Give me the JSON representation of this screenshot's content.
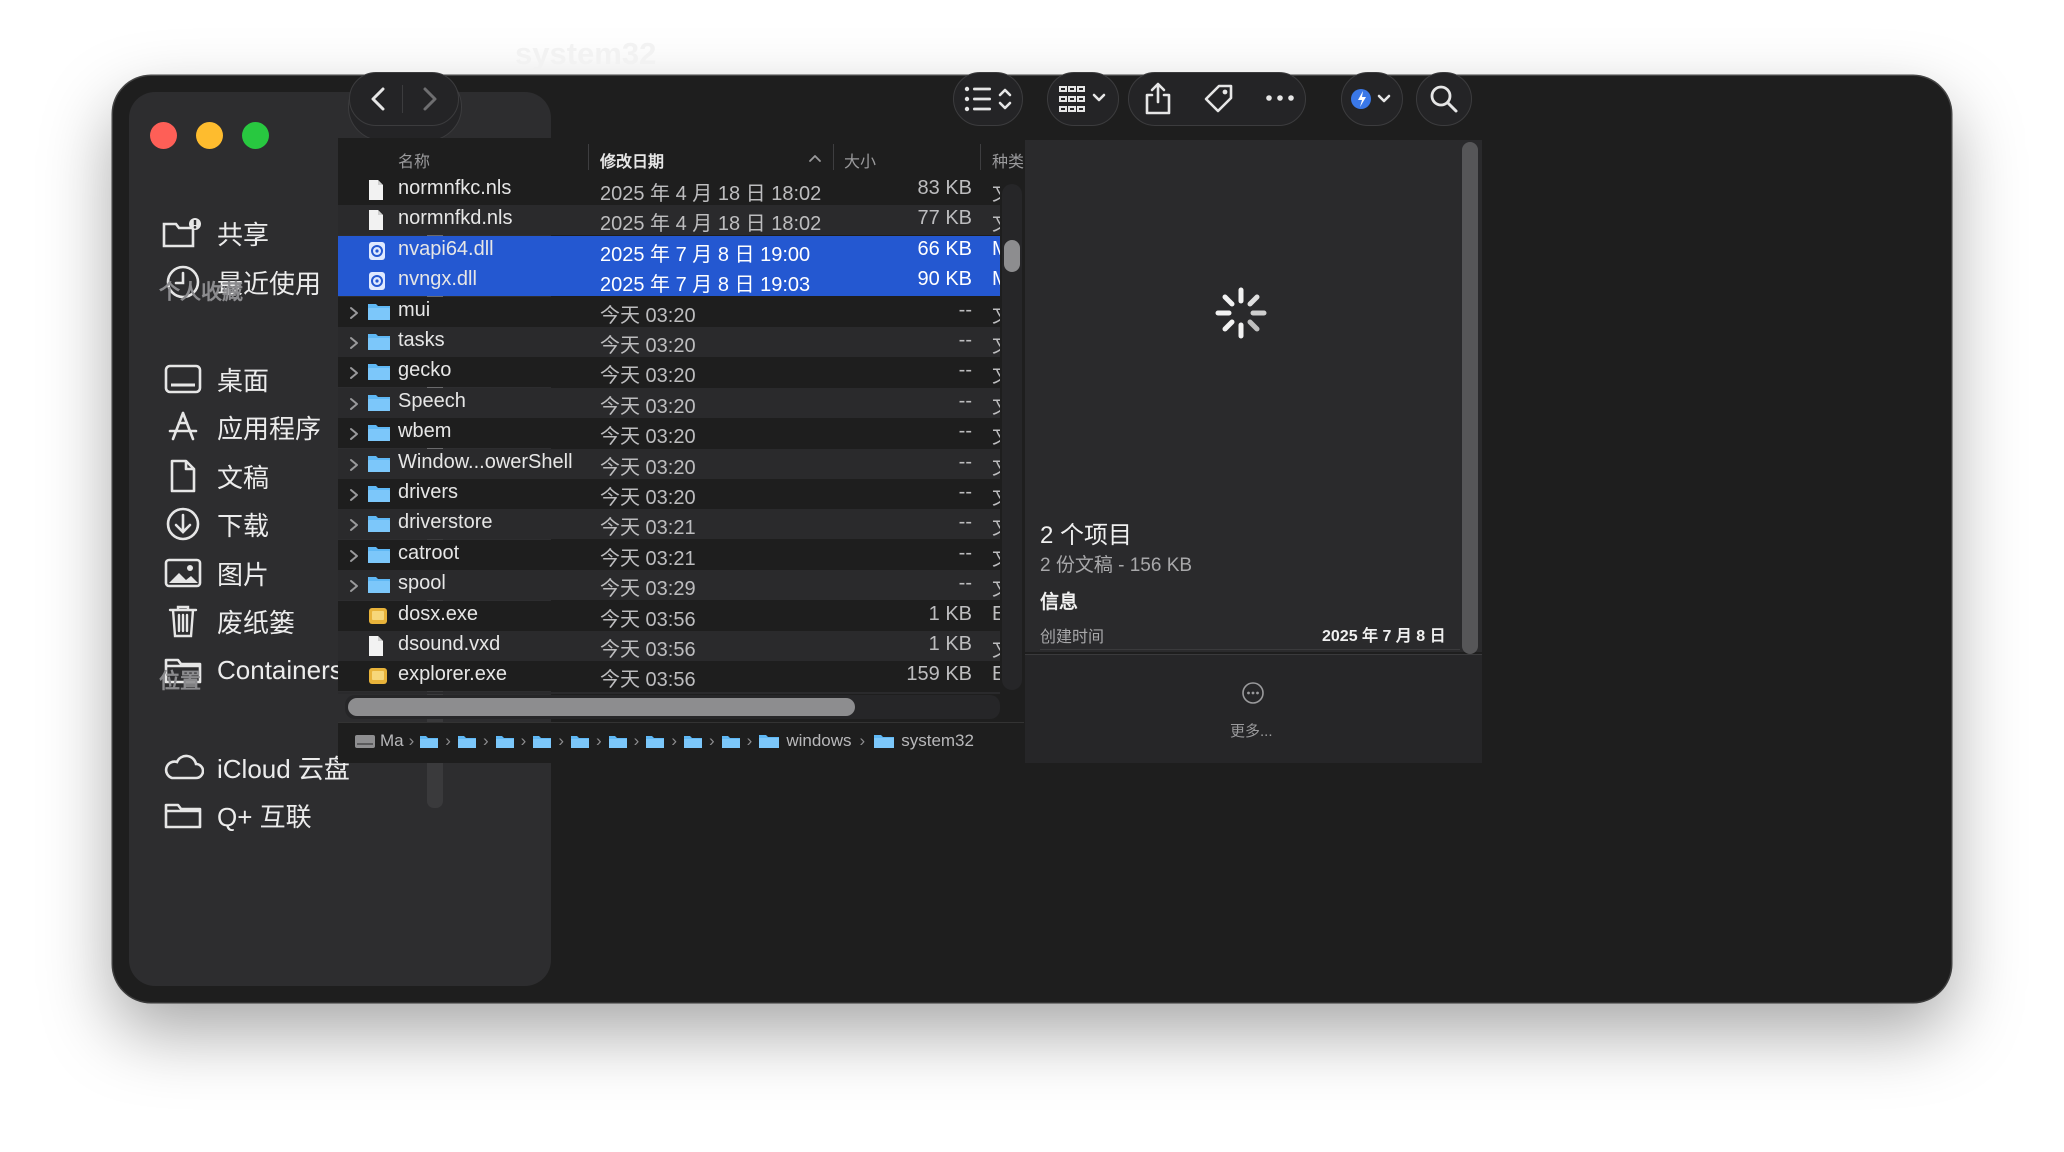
{
  "window": {
    "title": "system32"
  },
  "sidebar": {
    "top_items": [
      {
        "label": "共享",
        "icon": "shared-folder-icon"
      },
      {
        "label": "最近使用",
        "icon": "clock-icon"
      }
    ],
    "favorites_header": "个人收藏",
    "favorites": [
      {
        "label": "桌面",
        "icon": "desktop-icon"
      },
      {
        "label": "应用程序",
        "icon": "applications-icon"
      },
      {
        "label": "文稿",
        "icon": "document-icon"
      },
      {
        "label": "下载",
        "icon": "download-icon"
      },
      {
        "label": "图片",
        "icon": "photo-icon"
      },
      {
        "label": "废纸篓",
        "icon": "trash-icon"
      },
      {
        "label": "Containers",
        "icon": "folder-icon"
      }
    ],
    "locations_header": "位置",
    "locations": [
      {
        "label": "iCloud 云盘",
        "icon": "cloud-icon"
      },
      {
        "label": "Q+ 互联",
        "icon": "folder-icon"
      }
    ]
  },
  "columns": {
    "name": "名称",
    "date": "修改日期",
    "size": "大小",
    "kind": "种类"
  },
  "files": [
    {
      "name": "normnfkc.nls",
      "date": "2025 年 4 月 18 日 18:02",
      "size": "83 KB",
      "kind": "文",
      "type": "doc",
      "selected": false
    },
    {
      "name": "normnfkd.nls",
      "date": "2025 年 4 月 18 日 18:02",
      "size": "77 KB",
      "kind": "文",
      "type": "doc",
      "selected": false
    },
    {
      "name": "nvapi64.dll",
      "date": "2025 年 7 月 8 日 19:00",
      "size": "66 KB",
      "kind": "M",
      "type": "dll",
      "selected": true
    },
    {
      "name": "nvngx.dll",
      "date": "2025 年 7 月 8 日 19:03",
      "size": "90 KB",
      "kind": "M",
      "type": "dll",
      "selected": true
    },
    {
      "name": "mui",
      "date": "今天 03:20",
      "size": "--",
      "kind": "文",
      "type": "folder",
      "selected": false
    },
    {
      "name": "tasks",
      "date": "今天 03:20",
      "size": "--",
      "kind": "文",
      "type": "folder",
      "selected": false
    },
    {
      "name": "gecko",
      "date": "今天 03:20",
      "size": "--",
      "kind": "文",
      "type": "folder",
      "selected": false
    },
    {
      "name": "Speech",
      "date": "今天 03:20",
      "size": "--",
      "kind": "文",
      "type": "folder",
      "selected": false
    },
    {
      "name": "wbem",
      "date": "今天 03:20",
      "size": "--",
      "kind": "文",
      "type": "folder",
      "selected": false
    },
    {
      "name": "Window...owerShell",
      "date": "今天 03:20",
      "size": "--",
      "kind": "文",
      "type": "folder",
      "selected": false
    },
    {
      "name": "drivers",
      "date": "今天 03:20",
      "size": "--",
      "kind": "文",
      "type": "folder",
      "selected": false
    },
    {
      "name": "driverstore",
      "date": "今天 03:21",
      "size": "--",
      "kind": "文",
      "type": "folder",
      "selected": false
    },
    {
      "name": "catroot",
      "date": "今天 03:21",
      "size": "--",
      "kind": "文",
      "type": "folder",
      "selected": false
    },
    {
      "name": "spool",
      "date": "今天 03:29",
      "size": "--",
      "kind": "文",
      "type": "folder",
      "selected": false
    },
    {
      "name": "dosx.exe",
      "date": "今天 03:56",
      "size": "1 KB",
      "kind": "E",
      "type": "exe",
      "selected": false
    },
    {
      "name": "dsound.vxd",
      "date": "今天 03:56",
      "size": "1 KB",
      "kind": "文",
      "type": "doc",
      "selected": false
    },
    {
      "name": "explorer.exe",
      "date": "今天 03:56",
      "size": "159 KB",
      "kind": "E",
      "type": "exe",
      "selected": false
    },
    {
      "name": "",
      "date": "",
      "size": "",
      "kind": "",
      "type": "doc",
      "selected": false
    }
  ],
  "pathbar": {
    "root_label": "Ma",
    "folders": [
      "windows",
      "system32"
    ]
  },
  "preview": {
    "title": "2 个项目",
    "subtitle": "2 份文稿 - 156 KB",
    "info_header": "信息",
    "created_label": "创建时间",
    "created_value": "2025 年 7 月 8 日",
    "more_label": "更多..."
  },
  "colors": {
    "selection": "#2458d1",
    "folder_blue": "#5fb8f5",
    "traffic_red": "#fe5f57",
    "traffic_yellow": "#febc2e",
    "traffic_green": "#28c840"
  }
}
